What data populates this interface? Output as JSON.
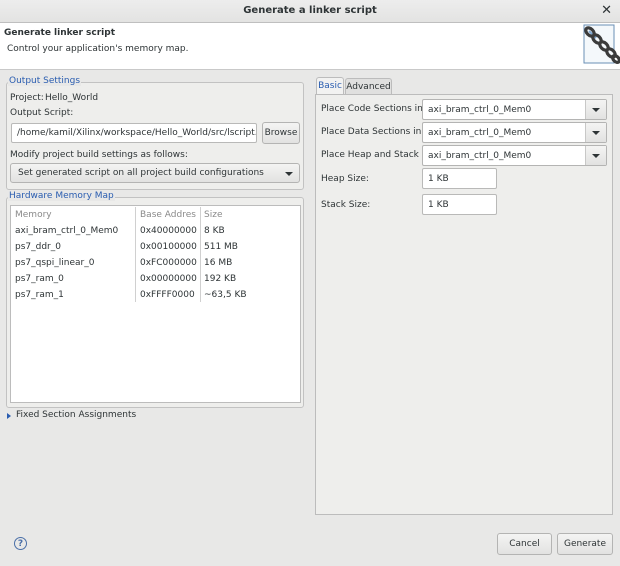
{
  "window": {
    "title": "Generate a linker script",
    "close_glyph": "✕"
  },
  "header": {
    "title": "Generate linker script",
    "description": "Control your application's memory map.",
    "icon": "chain-link-icon"
  },
  "output_settings": {
    "legend": "Output Settings",
    "project_label": "Project:",
    "project_value": "Hello_World",
    "output_script_label": "Output Script:",
    "output_script_value": "/home/kamil/Xilinx/workspace/Hello_World/src/lscript.ld",
    "browse_label": "Browse",
    "modify_label": "Modify project build settings as follows:",
    "modify_selected": "Set generated script on all project build configurations"
  },
  "hardware_memory_map": {
    "legend": "Hardware Memory Map",
    "columns": [
      "Memory",
      "Base Addres",
      "Size"
    ],
    "rows": [
      [
        "axi_bram_ctrl_0_Mem0",
        "0x40000000",
        "8 KB"
      ],
      [
        "ps7_ddr_0",
        "0x00100000",
        "511 MB"
      ],
      [
        "ps7_qspi_linear_0",
        "0xFC000000",
        "16 MB"
      ],
      [
        "ps7_ram_0",
        "0x00000000",
        "192 KB"
      ],
      [
        "ps7_ram_1",
        "0xFFFF0000",
        "~63,5 KB"
      ]
    ]
  },
  "fixed_section": {
    "label": "Fixed Section Assignments",
    "expanded": false
  },
  "tabs": {
    "basic": "Basic",
    "advanced": "Advanced",
    "active": "Basic"
  },
  "basic": {
    "code_label": "Place Code Sections in:",
    "code_value": "axi_bram_ctrl_0_Mem0",
    "data_label": "Place Data Sections in:",
    "data_value": "axi_bram_ctrl_0_Mem0",
    "heap_stack_label": "Place Heap and Stack in:",
    "heap_stack_value": "axi_bram_ctrl_0_Mem0",
    "heap_size_label": "Heap Size:",
    "heap_size_value": "1 KB",
    "stack_size_label": "Stack Size:",
    "stack_size_value": "1 KB"
  },
  "footer": {
    "help_glyph": "?",
    "cancel_label": "Cancel",
    "generate_label": "Generate"
  },
  "colors": {
    "accent": "#2a5db0",
    "background": "#e8e8e7",
    "header_bg": "#ffffff"
  }
}
